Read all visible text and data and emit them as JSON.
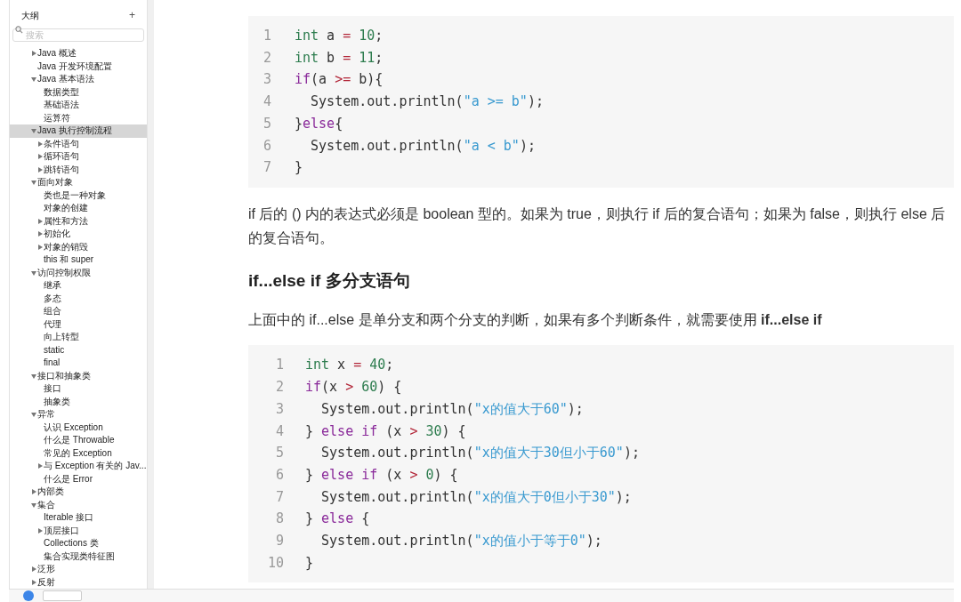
{
  "sidebar": {
    "title": "大纲",
    "add_button": "+",
    "search": {
      "placeholder": "搜索"
    },
    "items": [
      {
        "label": "Java 概述",
        "expanded": false,
        "selected": false
      },
      {
        "label": "Java 开发环境配置",
        "selected": false
      },
      {
        "label": "Java 基本语法",
        "expanded": true,
        "selected": false,
        "children": [
          {
            "label": "数据类型",
            "selected": false
          },
          {
            "label": "基础语法",
            "selected": false
          },
          {
            "label": "运算符",
            "selected": false
          }
        ]
      },
      {
        "label": "Java 执行控制流程",
        "expanded": true,
        "selected": true,
        "children": [
          {
            "label": "条件语句",
            "expanded": false,
            "selected": false
          },
          {
            "label": "循环语句",
            "expanded": false,
            "selected": false
          },
          {
            "label": "跳转语句",
            "expanded": false,
            "selected": false
          }
        ]
      },
      {
        "label": "面向对象",
        "expanded": true,
        "selected": false,
        "children": [
          {
            "label": "类也是一种对象",
            "selected": false
          },
          {
            "label": "对象的创建",
            "selected": false
          },
          {
            "label": "属性和方法",
            "expanded": false,
            "selected": false
          },
          {
            "label": "初始化",
            "expanded": false,
            "selected": false
          },
          {
            "label": "对象的销毁",
            "expanded": false,
            "selected": false
          },
          {
            "label": "this 和 super",
            "selected": false
          }
        ]
      },
      {
        "label": "访问控制权限",
        "expanded": true,
        "selected": false,
        "children": [
          {
            "label": "继承",
            "selected": false
          },
          {
            "label": "多态",
            "selected": false
          },
          {
            "label": "组合",
            "selected": false
          },
          {
            "label": "代理",
            "selected": false
          },
          {
            "label": "向上转型",
            "selected": false
          },
          {
            "label": "static",
            "selected": false
          },
          {
            "label": "final",
            "selected": false
          }
        ]
      },
      {
        "label": "接口和抽象类",
        "expanded": true,
        "selected": false,
        "children": [
          {
            "label": "接口",
            "selected": false
          },
          {
            "label": "抽象类",
            "selected": false
          }
        ]
      },
      {
        "label": "异常",
        "expanded": true,
        "selected": false,
        "children": [
          {
            "label": "认识 Exception",
            "selected": false
          },
          {
            "label": "什么是 Throwable",
            "selected": false
          },
          {
            "label": "常见的 Exception",
            "selected": false
          },
          {
            "label": "与 Exception 有关的 Jav...",
            "expanded": false,
            "selected": false
          },
          {
            "label": "什么是 Error",
            "selected": false
          }
        ]
      },
      {
        "label": "内部类",
        "expanded": false,
        "selected": false
      },
      {
        "label": "集合",
        "expanded": true,
        "selected": false,
        "children": [
          {
            "label": "Iterable 接口",
            "selected": false
          },
          {
            "label": "顶层接口",
            "expanded": false,
            "selected": false
          },
          {
            "label": "Collections 类",
            "selected": false
          },
          {
            "label": "集合实现类特征图",
            "selected": false
          }
        ]
      },
      {
        "label": "泛形",
        "expanded": false,
        "selected": false
      },
      {
        "label": "反射",
        "expanded": false,
        "selected": false
      }
    ]
  },
  "content": [
    {
      "kind": "code",
      "lines": [
        {
          "number": "1",
          "tokens": [
            {
              "t": "int",
              "kind": "type"
            },
            {
              "t": " a ",
              "kind": "plain"
            },
            {
              "t": "=",
              "kind": "op"
            },
            {
              "t": " 10",
              "kind": "number"
            },
            {
              "t": ";",
              "kind": "plain"
            }
          ]
        },
        {
          "number": "2",
          "tokens": [
            {
              "t": "int",
              "kind": "type"
            },
            {
              "t": " b ",
              "kind": "plain"
            },
            {
              "t": "=",
              "kind": "op"
            },
            {
              "t": " 11",
              "kind": "number"
            },
            {
              "t": ";",
              "kind": "plain"
            }
          ]
        },
        {
          "number": "3",
          "tokens": [
            {
              "t": "if",
              "kind": "keyword"
            },
            {
              "t": "(a ",
              "kind": "plain"
            },
            {
              "t": ">=",
              "kind": "op"
            },
            {
              "t": " b){",
              "kind": "plain"
            }
          ]
        },
        {
          "number": "4",
          "tokens": [
            {
              "t": "  System.out.println(",
              "kind": "plain"
            },
            {
              "t": "\"a >= b\"",
              "kind": "string"
            },
            {
              "t": ");",
              "kind": "plain"
            }
          ]
        },
        {
          "number": "5",
          "tokens": [
            {
              "t": "}",
              "kind": "plain"
            },
            {
              "t": "else",
              "kind": "keyword"
            },
            {
              "t": "{",
              "kind": "plain"
            }
          ]
        },
        {
          "number": "6",
          "tokens": [
            {
              "t": "  System.out.println(",
              "kind": "plain"
            },
            {
              "t": "\"a < b\"",
              "kind": "string"
            },
            {
              "t": ");",
              "kind": "plain"
            }
          ]
        },
        {
          "number": "7",
          "tokens": [
            {
              "t": "}",
              "kind": "plain"
            }
          ]
        }
      ]
    },
    {
      "kind": "paragraph",
      "text": "if 后的 () 内的表达式必须是 boolean 型的。如果为 true，则执行 if 后的复合语句；如果为 false，则执行 else 后的复合语句。"
    },
    {
      "kind": "heading",
      "text": "if...else if 多分支语句"
    },
    {
      "kind": "paragraph",
      "text": "上面中的 if...else 是单分支和两个分支的判断，如果有多个判断条件，就需要使用 **if...else if**"
    },
    {
      "kind": "code",
      "lines": [
        {
          "number": "1",
          "tokens": [
            {
              "t": "int",
              "kind": "type"
            },
            {
              "t": " x ",
              "kind": "plain"
            },
            {
              "t": "=",
              "kind": "op"
            },
            {
              "t": " 40",
              "kind": "number"
            },
            {
              "t": ";",
              "kind": "plain"
            }
          ]
        },
        {
          "number": "2",
          "tokens": [
            {
              "t": "if",
              "kind": "keyword"
            },
            {
              "t": "(x ",
              "kind": "plain"
            },
            {
              "t": ">",
              "kind": "op"
            },
            {
              "t": " 60",
              "kind": "number"
            },
            {
              "t": ") {",
              "kind": "plain"
            }
          ]
        },
        {
          "number": "3",
          "tokens": [
            {
              "t": "  System.out.println(",
              "kind": "plain"
            },
            {
              "t": "\"x的值大于60\"",
              "kind": "string"
            },
            {
              "t": ");",
              "kind": "plain"
            }
          ]
        },
        {
          "number": "4",
          "tokens": [
            {
              "t": "} ",
              "kind": "plain"
            },
            {
              "t": "else if",
              "kind": "keyword"
            },
            {
              "t": " (x ",
              "kind": "plain"
            },
            {
              "t": ">",
              "kind": "op"
            },
            {
              "t": " 30",
              "kind": "number"
            },
            {
              "t": ") {",
              "kind": "plain"
            }
          ]
        },
        {
          "number": "5",
          "tokens": [
            {
              "t": "  System.out.println(",
              "kind": "plain"
            },
            {
              "t": "\"x的值大于30但小于60\"",
              "kind": "string"
            },
            {
              "t": ");",
              "kind": "plain"
            }
          ]
        },
        {
          "number": "6",
          "tokens": [
            {
              "t": "} ",
              "kind": "plain"
            },
            {
              "t": "else if",
              "kind": "keyword"
            },
            {
              "t": " (x ",
              "kind": "plain"
            },
            {
              "t": ">",
              "kind": "op"
            },
            {
              "t": " 0",
              "kind": "number"
            },
            {
              "t": ") {",
              "kind": "plain"
            }
          ]
        },
        {
          "number": "7",
          "tokens": [
            {
              "t": "  System.out.println(",
              "kind": "plain"
            },
            {
              "t": "\"x的值大于0但小于30\"",
              "kind": "string"
            },
            {
              "t": ");",
              "kind": "plain"
            }
          ]
        },
        {
          "number": "8",
          "tokens": [
            {
              "t": "} ",
              "kind": "plain"
            },
            {
              "t": "else",
              "kind": "keyword"
            },
            {
              "t": " {",
              "kind": "plain"
            }
          ]
        },
        {
          "number": "9",
          "tokens": [
            {
              "t": "  System.out.println(",
              "kind": "plain"
            },
            {
              "t": "\"x的值小于等于0\"",
              "kind": "string"
            },
            {
              "t": ");",
              "kind": "plain"
            }
          ]
        },
        {
          "number": "10",
          "tokens": [
            {
              "t": "}",
              "kind": "plain"
            }
          ]
        }
      ]
    }
  ]
}
